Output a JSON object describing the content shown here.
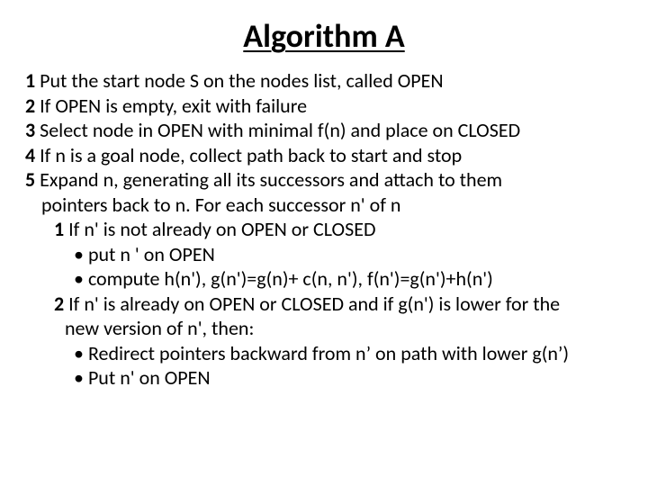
{
  "title": "Algorithm A",
  "steps": {
    "s1": {
      "num": "1",
      "text": " Put the start node S on the nodes list, called OPEN"
    },
    "s2": {
      "num": "2",
      "text": " If OPEN is empty, exit with failure"
    },
    "s3": {
      "num": "3",
      "text": " Select node in OPEN with minimal f(n) and place on CLOSED"
    },
    "s4": {
      "num": "4",
      "text": " If n is a goal node, collect path back to start and stop"
    },
    "s5": {
      "num": "5",
      "text": " Expand n, generating all its successors and attach to them",
      "cont": "pointers back to n.  For each successor n' of n"
    },
    "s5_1": {
      "num": "1",
      "text": " If n' is not already on OPEN or CLOSED"
    },
    "s5_1_b1": "put n ' on OPEN",
    "s5_1_b2": "compute h(n'),  g(n')=g(n)+ c(n, n'),  f(n')=g(n')+h(n')",
    "s5_2": {
      "num": "2",
      "text": " If n' is already on OPEN or CLOSED and if g(n') is lower for the",
      "cont": "new version of n', then:"
    },
    "s5_2_b1": "Redirect pointers backward from n’ on path with lower g(n’)",
    "s5_2_b2": "Put n' on OPEN"
  }
}
